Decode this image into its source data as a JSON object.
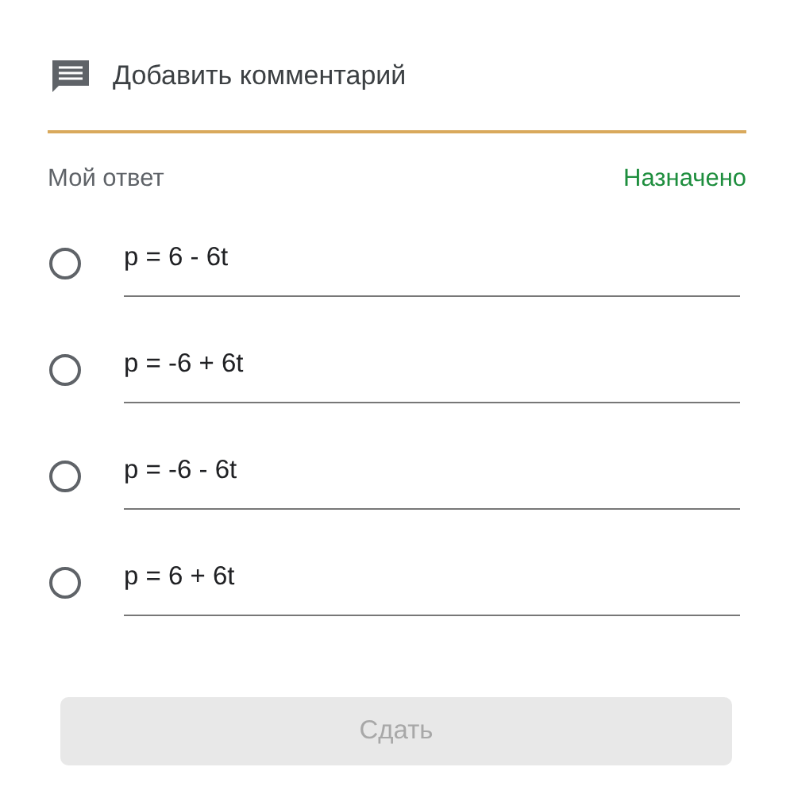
{
  "comment": {
    "label": "Добавить комментарий"
  },
  "answer": {
    "title": "Мой ответ",
    "status": "Назначено"
  },
  "options": [
    {
      "label": "p = 6 - 6t",
      "selected": false
    },
    {
      "label": "p = -6 + 6t",
      "selected": false
    },
    {
      "label": "p = -6 - 6t",
      "selected": false
    },
    {
      "label": "p = 6 + 6t",
      "selected": false
    }
  ],
  "submit": {
    "label": "Сдать",
    "disabled": true
  }
}
